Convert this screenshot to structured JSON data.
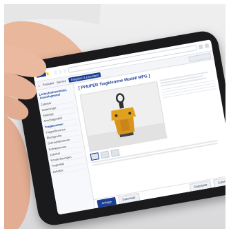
{
  "page": {
    "brand_color": "#1c3f94",
    "accent_color": "#ffcc00"
  },
  "topbar": {
    "tab_1": "",
    "tab_2": "",
    "tab_3": "",
    "user_text": ""
  },
  "navbar": {
    "items": [
      "Produkte",
      "Service",
      "Ratgeber & Lösungen"
    ]
  },
  "sidebar": {
    "heading": "Lastaufnahmemittel, Anschlagmittel",
    "items": [
      "Zubehör",
      "Kettenzüge",
      "Seilzüge",
      "Anschlagmittel",
      "Tragklemmen",
      "Trägerklemmen",
      "Blechgreifer",
      "Schraubklemmen",
      "Rohrklemmen",
      "Zubehör",
      "Sonderlösungen",
      "Tragmittel",
      "Zubehör"
    ]
  },
  "product": {
    "title": "[ PFEIFER Tragklemme Modell MFG ]"
  },
  "actions": {
    "primary": "Anfrage",
    "secondary": "Datenblatt",
    "third": "Datenblatt",
    "fourth": "Zubehör"
  }
}
